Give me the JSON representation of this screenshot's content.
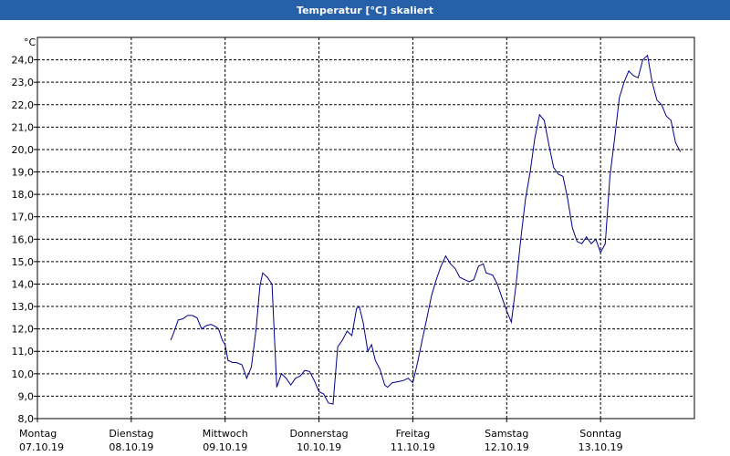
{
  "window": {
    "title": "Temperatur [°C] skaliert"
  },
  "chart_data": {
    "type": "line",
    "title": "Temperatur [°C] skaliert",
    "ylabel": "°C",
    "xlabel": "",
    "ylim": [
      8.0,
      25.0
    ],
    "yticks": [
      "8,0",
      "9,0",
      "10,0",
      "11,0",
      "12,0",
      "13,0",
      "14,0",
      "15,0",
      "16,0",
      "17,0",
      "18,0",
      "19,0",
      "20,0",
      "21,0",
      "22,0",
      "23,0",
      "24,0"
    ],
    "xlim": [
      0,
      7
    ],
    "days": [
      {
        "weekday": "Montag",
        "date": "07.10.19"
      },
      {
        "weekday": "Dienstag",
        "date": "08.10.19"
      },
      {
        "weekday": "Mittwoch",
        "date": "09.10.19"
      },
      {
        "weekday": "Donnerstag",
        "date": "10.10.19"
      },
      {
        "weekday": "Freitag",
        "date": "11.10.19"
      },
      {
        "weekday": "Samstag",
        "date": "12.10.19"
      },
      {
        "weekday": "Sonntag",
        "date": "13.10.19"
      }
    ],
    "grid": true,
    "line_color": "#00008b",
    "series": [
      {
        "points": [
          [
            1.42,
            11.5
          ],
          [
            1.45,
            11.8
          ],
          [
            1.5,
            12.4
          ],
          [
            1.55,
            12.45
          ],
          [
            1.6,
            12.6
          ],
          [
            1.65,
            12.6
          ],
          [
            1.7,
            12.5
          ],
          [
            1.75,
            12.0
          ],
          [
            1.8,
            12.15
          ],
          [
            1.85,
            12.2
          ],
          [
            1.9,
            12.1
          ],
          [
            1.93,
            12.0
          ],
          [
            1.97,
            11.5
          ],
          [
            2.0,
            11.3
          ],
          [
            2.03,
            10.6
          ],
          [
            2.08,
            10.5
          ],
          [
            2.12,
            10.5
          ],
          [
            2.18,
            10.4
          ],
          [
            2.23,
            9.8
          ],
          [
            2.28,
            10.3
          ],
          [
            2.33,
            12.0
          ],
          [
            2.37,
            13.9
          ],
          [
            2.4,
            14.5
          ],
          [
            2.45,
            14.3
          ],
          [
            2.5,
            14.0
          ],
          [
            2.55,
            9.4
          ],
          [
            2.6,
            10.0
          ],
          [
            2.65,
            9.8
          ],
          [
            2.7,
            9.5
          ],
          [
            2.75,
            9.8
          ],
          [
            2.8,
            9.9
          ],
          [
            2.85,
            10.15
          ],
          [
            2.9,
            10.1
          ],
          [
            2.95,
            9.7
          ],
          [
            3.0,
            9.2
          ],
          [
            3.05,
            9.1
          ],
          [
            3.1,
            8.7
          ],
          [
            3.15,
            8.65
          ],
          [
            3.2,
            11.2
          ],
          [
            3.25,
            11.5
          ],
          [
            3.3,
            11.9
          ],
          [
            3.35,
            11.7
          ],
          [
            3.4,
            12.9
          ],
          [
            3.43,
            13.0
          ],
          [
            3.47,
            12.3
          ],
          [
            3.52,
            11.0
          ],
          [
            3.56,
            11.3
          ],
          [
            3.6,
            10.6
          ],
          [
            3.65,
            10.2
          ],
          [
            3.7,
            9.5
          ],
          [
            3.73,
            9.4
          ],
          [
            3.78,
            9.6
          ],
          [
            3.85,
            9.65
          ],
          [
            3.9,
            9.7
          ],
          [
            3.95,
            9.8
          ],
          [
            4.0,
            9.6
          ],
          [
            4.05,
            10.5
          ],
          [
            4.1,
            11.5
          ],
          [
            4.15,
            12.5
          ],
          [
            4.2,
            13.5
          ],
          [
            4.25,
            14.2
          ],
          [
            4.3,
            14.8
          ],
          [
            4.35,
            15.25
          ],
          [
            4.4,
            14.9
          ],
          [
            4.45,
            14.7
          ],
          [
            4.5,
            14.3
          ],
          [
            4.55,
            14.2
          ],
          [
            4.6,
            14.1
          ],
          [
            4.65,
            14.2
          ],
          [
            4.7,
            14.8
          ],
          [
            4.75,
            14.9
          ],
          [
            4.78,
            14.5
          ],
          [
            4.85,
            14.4
          ],
          [
            4.9,
            14.0
          ],
          [
            4.95,
            13.4
          ],
          [
            5.0,
            12.8
          ],
          [
            5.05,
            12.3
          ],
          [
            5.1,
            14.0
          ],
          [
            5.15,
            16.0
          ],
          [
            5.2,
            17.8
          ],
          [
            5.25,
            19.0
          ],
          [
            5.3,
            20.5
          ],
          [
            5.35,
            21.55
          ],
          [
            5.4,
            21.3
          ],
          [
            5.45,
            20.2
          ],
          [
            5.5,
            19.2
          ],
          [
            5.55,
            18.9
          ],
          [
            5.6,
            18.8
          ],
          [
            5.65,
            17.8
          ],
          [
            5.7,
            16.5
          ],
          [
            5.75,
            15.9
          ],
          [
            5.8,
            15.8
          ],
          [
            5.85,
            16.1
          ],
          [
            5.9,
            15.8
          ],
          [
            5.95,
            16.0
          ],
          [
            6.0,
            15.4
          ],
          [
            6.05,
            15.8
          ],
          [
            6.1,
            18.8
          ],
          [
            6.15,
            20.5
          ],
          [
            6.2,
            22.3
          ],
          [
            6.25,
            23.0
          ],
          [
            6.3,
            23.5
          ],
          [
            6.35,
            23.3
          ],
          [
            6.4,
            23.2
          ],
          [
            6.45,
            24.0
          ],
          [
            6.5,
            24.2
          ],
          [
            6.55,
            23.0
          ],
          [
            6.6,
            22.2
          ],
          [
            6.65,
            22.0
          ],
          [
            6.7,
            21.5
          ],
          [
            6.75,
            21.3
          ],
          [
            6.8,
            20.3
          ],
          [
            6.85,
            19.9
          ]
        ]
      }
    ]
  }
}
